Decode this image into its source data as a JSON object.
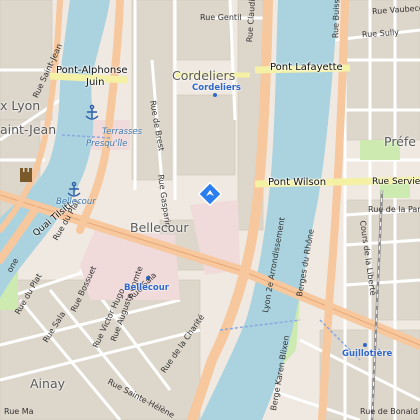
{
  "map": {
    "colors": {
      "background": "#efe9e1",
      "block": "#ddd6cb",
      "water": "#aad3df",
      "major_road": "#f7c79d",
      "secondary_road": "#f4f0a4",
      "park": "#cdebb0",
      "square": "#f0dada",
      "railway": "#8c8c8c",
      "metro": "#8aa8e0",
      "marker": "#2a7ef0"
    },
    "marker": {
      "name": "selected-location",
      "icon": "diamond-arrow-icon"
    },
    "labels": {
      "rue_gentil": "Rue Gentil",
      "rue_claudia": "Rue Claudia",
      "rue_buisson": "Rue Buisson",
      "rue_sully": "Rue Sully",
      "rue_vaubecour": "Rue Vaubecour",
      "rue_de_bonald": "Rue de Bonald",
      "rue_de_la_part_dieu": "Rue de la Part-Dieu",
      "rue_servient": "Rue Servient",
      "rue_saint_jean": "Rue Saint-Jean",
      "rue_de_brest": "Rue de Brest",
      "rue_gasparin": "Rue Gasparin",
      "quai_tilsitt": "Quai Tilsitt",
      "rue_du_plat": "Rue du Plat",
      "rue_bossuet": "Rue Bossuet",
      "rue_victor_hugo": "Rue Victor Hugo",
      "rue_auguste_comte": "Rue Auguste Comte",
      "rue_sala": "Rue Sala",
      "rue_sainte_helene": "Rue Sainte-Hélène",
      "rue_de_la_charite": "Rue de la Charité",
      "cours_de_la_liberte": "Cours de la Liberté",
      "berges_du_rhone": "Berges du Rhône",
      "lyon_2e": "Lyon 2e Arrondissement",
      "berge_karen_blixen": "Berge Karen Blixen",
      "pont_alphonse_juin_1": "Pont-Alphonse",
      "pont_alphonse_juin_2": "Juin",
      "pont_lafayette": "Pont Lafayette",
      "pont_wilson": "Pont Wilson",
      "cordeliers_quarter": "Cordeliers",
      "cordeliers_station": "Cordeliers",
      "bellecour_quarter": "Bellecour",
      "bellecour_station": "Bellecour",
      "guillotiere": "Guillotière",
      "ainay": "Ainay",
      "prefecture": "Préfe",
      "lyon_edge": "x Lyon",
      "saint_jean_edge": "aint-Jean",
      "terrasses_1": "Terrasses",
      "terrasses_2": "Presqu'île",
      "bellecour_poi": "Bellecour",
      "rue_ma": "Rue Ma",
      "quai_edge": "one"
    }
  }
}
